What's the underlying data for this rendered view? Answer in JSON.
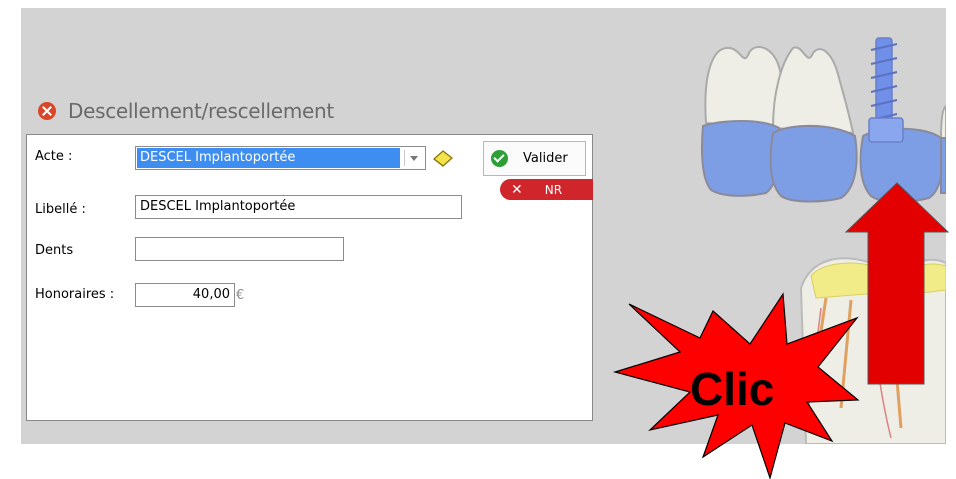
{
  "dialog": {
    "title": "Descellement/rescellement",
    "acte_label": "Acte :",
    "acte_value": "DESCEL Implantoportée",
    "libelle_label": "Libellé :",
    "libelle_value": "DESCEL Implantoportée",
    "dents_label": "Dents",
    "dents_value": "",
    "honoraires_label": "Honoraires :",
    "honoraires_value": "40,00",
    "currency": "€"
  },
  "buttons": {
    "valider_label": "Valider",
    "nr_label": "NR"
  },
  "annotation": {
    "callout_text": "Clic"
  },
  "icons": [
    "close-icon",
    "check-icon",
    "eraser-icon",
    "chevron-down-icon"
  ],
  "colors": {
    "accent": "#3d8ef0",
    "nr_red": "#d0252b",
    "valid_green": "#2e9e36",
    "arrow_red": "#e30000"
  }
}
